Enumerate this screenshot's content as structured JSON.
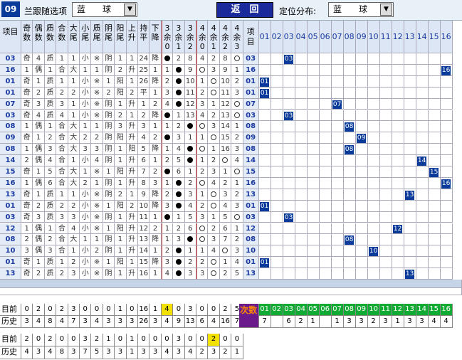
{
  "toolbar": {
    "period": "09",
    "filter_label": "兰跟随选项",
    "filter_value": "蓝　　球",
    "back_label": "返　回",
    "position_label": "定位分布:",
    "position_value": "蓝　　球",
    "dropdown_glyph": "▼"
  },
  "headers": {
    "item": "项目",
    "attr": [
      "奇数",
      "偶数",
      "质数",
      "合数",
      "大尾",
      "小尾",
      "质尾",
      "阴尾",
      "阳尾",
      "上升",
      "持平",
      "下降",
      "3余0",
      "3余1",
      "3余2",
      "4余0",
      "4余1",
      "4余2",
      "4余3"
    ],
    "item_right": "项目",
    "nums": [
      "01",
      "02",
      "03",
      "04",
      "05",
      "06",
      "07",
      "08",
      "09",
      "10",
      "11",
      "12",
      "13",
      "14",
      "15",
      "16"
    ]
  },
  "rows": [
    {
      "id": "03",
      "a": [
        "奇",
        "4",
        "质",
        "1",
        "1",
        "小",
        "※",
        "阴",
        "1",
        "1",
        "24",
        "降",
        "●",
        "2",
        "8",
        "4",
        "2",
        "8",
        "◎"
      ],
      "hit": 3
    },
    {
      "id": "16",
      "a": [
        "1",
        "偶",
        "1",
        "合",
        "大",
        "1",
        "1",
        "阴",
        "2",
        "升",
        "25",
        "1",
        "1",
        "●",
        "9",
        "◎",
        "3",
        "9",
        "1"
      ],
      "hit": 16
    },
    {
      "id": "01",
      "a": [
        "奇",
        "1",
        "质",
        "1",
        "1",
        "小",
        "※",
        "1",
        "阳",
        "1",
        "26",
        "降",
        "2",
        "●",
        "10",
        "1",
        "◎",
        "10",
        "2"
      ],
      "hit": 1
    },
    {
      "id": "01",
      "a": [
        "奇",
        "2",
        "质",
        "2",
        "2",
        "小",
        "※",
        "2",
        "阳",
        "2",
        "平",
        "1",
        "3",
        "●",
        "11",
        "2",
        "◎",
        "11",
        "3"
      ],
      "hit": 1
    },
    {
      "id": "07",
      "a": [
        "奇",
        "3",
        "质",
        "3",
        "1",
        "小",
        "※",
        "阴",
        "1",
        "升",
        "1",
        "2",
        "4",
        "●",
        "12",
        "3",
        "1",
        "12",
        "◎"
      ],
      "hit": 7
    },
    {
      "id": "03",
      "a": [
        "奇",
        "4",
        "质",
        "4",
        "1",
        "小",
        "※",
        "阴",
        "2",
        "1",
        "2",
        "降",
        "●",
        "1",
        "13",
        "4",
        "2",
        "13",
        "◎"
      ],
      "hit": 3
    },
    {
      "id": "08",
      "a": [
        "1",
        "偶",
        "1",
        "合",
        "大",
        "1",
        "1",
        "阴",
        "3",
        "升",
        "3",
        "1",
        "1",
        "2",
        "●",
        "◎",
        "3",
        "14",
        "1"
      ],
      "hit": 8
    },
    {
      "id": "09",
      "a": [
        "奇",
        "1",
        "2",
        "合",
        "大",
        "2",
        "2",
        "阴",
        "阳",
        "升",
        "4",
        "2",
        "●",
        "3",
        "1",
        "1",
        "◎",
        "15",
        "2"
      ],
      "hit": 9
    },
    {
      "id": "08",
      "a": [
        "1",
        "偶",
        "3",
        "合",
        "大",
        "3",
        "3",
        "阴",
        "1",
        "阳",
        "5",
        "降",
        "1",
        "4",
        "●",
        "◎",
        "1",
        "16",
        "3"
      ],
      "hit": 8
    },
    {
      "id": "14",
      "a": [
        "2",
        "偶",
        "4",
        "合",
        "1",
        "小",
        "4",
        "阴",
        "1",
        "升",
        "6",
        "1",
        "2",
        "5",
        "●",
        "1",
        "2",
        "◎",
        "4"
      ],
      "hit": 14
    },
    {
      "id": "15",
      "a": [
        "奇",
        "1",
        "5",
        "合",
        "大",
        "1",
        "※",
        "1",
        "阳",
        "升",
        "7",
        "2",
        "●",
        "6",
        "1",
        "2",
        "3",
        "1",
        "◎"
      ],
      "hit": 15
    },
    {
      "id": "16",
      "a": [
        "1",
        "偶",
        "6",
        "合",
        "大",
        "2",
        "1",
        "阴",
        "1",
        "升",
        "8",
        "3",
        "1",
        "●",
        "2",
        "◎",
        "4",
        "2",
        "1"
      ],
      "hit": 16
    },
    {
      "id": "13",
      "a": [
        "奇",
        "1",
        "质",
        "1",
        "1",
        "小",
        "※",
        "阴",
        "2",
        "1",
        "9",
        "降",
        "2",
        "●",
        "3",
        "1",
        "◎",
        "3",
        "2"
      ],
      "hit": 13
    },
    {
      "id": "01",
      "a": [
        "奇",
        "2",
        "质",
        "2",
        "2",
        "小",
        "※",
        "1",
        "阳",
        "2",
        "10",
        "降",
        "3",
        "●",
        "4",
        "2",
        "◎",
        "4",
        "3"
      ],
      "hit": 1
    },
    {
      "id": "03",
      "a": [
        "奇",
        "3",
        "质",
        "3",
        "3",
        "小",
        "※",
        "阴",
        "1",
        "升",
        "11",
        "1",
        "●",
        "1",
        "5",
        "3",
        "1",
        "5",
        "◎"
      ],
      "hit": 3
    },
    {
      "id": "12",
      "a": [
        "1",
        "偶",
        "1",
        "合",
        "4",
        "小",
        "※",
        "1",
        "阳",
        "升",
        "12",
        "2",
        "1",
        "2",
        "6",
        "◎",
        "2",
        "6",
        "1"
      ],
      "hit": 12
    },
    {
      "id": "08",
      "a": [
        "2",
        "偶",
        "2",
        "合",
        "大",
        "1",
        "1",
        "阴",
        "1",
        "升",
        "13",
        "降",
        "1",
        "3",
        "●",
        "◎",
        "3",
        "7",
        "2"
      ],
      "hit": 8
    },
    {
      "id": "10",
      "a": [
        "3",
        "偶",
        "3",
        "合",
        "1",
        "小",
        "2",
        "阴",
        "1",
        "升",
        "14",
        "1",
        "2",
        "●",
        "1",
        "1",
        "4",
        "◎",
        "3"
      ],
      "hit": 10
    },
    {
      "id": "01",
      "a": [
        "奇",
        "1",
        "质",
        "1",
        "2",
        "小",
        "※",
        "1",
        "阳",
        "1",
        "15",
        "降",
        "3",
        "●",
        "2",
        "2",
        "◎",
        "1",
        "4"
      ],
      "hit": 1
    },
    {
      "id": "13",
      "a": [
        "奇",
        "2",
        "质",
        "2",
        "3",
        "小",
        "※",
        "阴",
        "1",
        "升",
        "16",
        "1",
        "4",
        "●",
        "3",
        "3",
        "◎",
        "2",
        "5"
      ],
      "hit": 13
    }
  ],
  "footer": {
    "current_label": "目前",
    "history_label": "历史",
    "current": [
      "0",
      "2",
      "0",
      "2",
      "3",
      "0",
      "0",
      "0",
      "1",
      "0",
      "16",
      "1",
      "4",
      "0",
      "3",
      "0",
      "0",
      "2",
      "5"
    ],
    "history": [
      "3",
      "4",
      "8",
      "4",
      "7",
      "3",
      "4",
      "3",
      "3",
      "3",
      "26",
      "3",
      "4",
      "9",
      "13",
      "6",
      "4",
      "16",
      "7"
    ],
    "next_label": "次数",
    "next_nums": [
      "01",
      "02",
      "03",
      "04",
      "05",
      "06",
      "07",
      "08",
      "09",
      "10",
      "11",
      "12",
      "13",
      "14",
      "15",
      "16"
    ],
    "next_counts": [
      "7",
      "",
      "6",
      "2",
      "1",
      "",
      "1",
      "3",
      "3",
      "2",
      "3",
      "1",
      "3",
      "3",
      "4",
      "4"
    ],
    "current2": [
      "2",
      "0",
      "2",
      "0",
      "0",
      "3",
      "2",
      "1",
      "0",
      "1",
      "0",
      "0",
      "0",
      "3",
      "0",
      "0",
      "2",
      "0",
      "0"
    ],
    "history2": [
      "4",
      "3",
      "4",
      "8",
      "3",
      "7",
      "5",
      "3",
      "3",
      "1",
      "3",
      "3",
      "4",
      "3",
      "4",
      "2",
      "3",
      "2",
      "1",
      "3"
    ],
    "current2_highlight": 16,
    "current_highlight": 12
  }
}
